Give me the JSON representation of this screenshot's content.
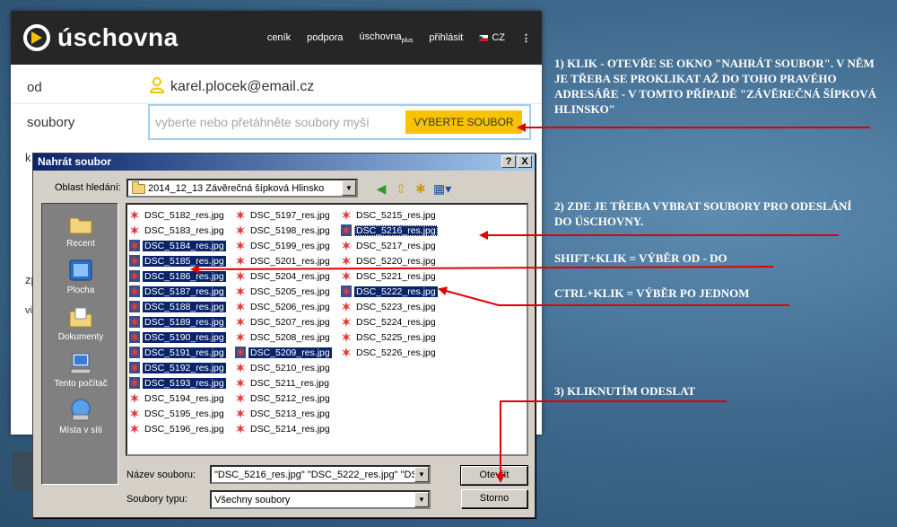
{
  "web": {
    "logo_text": "úschovna",
    "nav": {
      "pricing": "ceník",
      "support": "podpora",
      "plus_main": "úschovna",
      "plus_sub": "plus",
      "login": "přihlásit",
      "lang": "CZ"
    },
    "form": {
      "from_label": "od",
      "from_value": "karel.plocek@email.cz",
      "files_label": "soubory",
      "files_placeholder": "vyberte nebo přetáhněte soubory myší",
      "select_button": "VYBERTE SOUBOR",
      "frag_ko": "k",
      "frag_zp": "zp",
      "frag_vi": "vi"
    }
  },
  "dialog": {
    "title": "Nahrát soubor",
    "help_btn": "?",
    "close_btn": "X",
    "lookin_label": "Oblast hledání:",
    "lookin_value": "2014_12_13 Závěrečná šípková Hlinsko",
    "places": [
      "Recent",
      "Plocha",
      "Dokumenty",
      "Tento počítač",
      "Místa v síti"
    ],
    "columns": [
      [
        {
          "name": "DSC_5182_res.jpg",
          "selected": false
        },
        {
          "name": "DSC_5183_res.jpg",
          "selected": false
        },
        {
          "name": "DSC_5184_res.jpg",
          "selected": true
        },
        {
          "name": "DSC_5185_res.jpg",
          "selected": true
        },
        {
          "name": "DSC_5186_res.jpg",
          "selected": true
        },
        {
          "name": "DSC_5187_res.jpg",
          "selected": true
        },
        {
          "name": "DSC_5188_res.jpg",
          "selected": true
        },
        {
          "name": "DSC_5189_res.jpg",
          "selected": true
        },
        {
          "name": "DSC_5190_res.jpg",
          "selected": true
        },
        {
          "name": "DSC_5191_res.jpg",
          "selected": true
        },
        {
          "name": "DSC_5192_res.jpg",
          "selected": true
        },
        {
          "name": "DSC_5193_res.jpg",
          "selected": true
        },
        {
          "name": "DSC_5194_res.jpg",
          "selected": false
        },
        {
          "name": "DSC_5195_res.jpg",
          "selected": false
        },
        {
          "name": "DSC_5196_res.jpg",
          "selected": false
        }
      ],
      [
        {
          "name": "DSC_5197_res.jpg",
          "selected": false
        },
        {
          "name": "DSC_5198_res.jpg",
          "selected": false
        },
        {
          "name": "DSC_5199_res.jpg",
          "selected": false
        },
        {
          "name": "DSC_5201_res.jpg",
          "selected": false
        },
        {
          "name": "DSC_5204_res.jpg",
          "selected": false
        },
        {
          "name": "DSC_5205_res.jpg",
          "selected": false
        },
        {
          "name": "DSC_5206_res.jpg",
          "selected": false
        },
        {
          "name": "DSC_5207_res.jpg",
          "selected": false
        },
        {
          "name": "DSC_5208_res.jpg",
          "selected": false
        },
        {
          "name": "DSC_5209_res.jpg",
          "selected": true
        },
        {
          "name": "DSC_5210_res.jpg",
          "selected": false
        },
        {
          "name": "DSC_5211_res.jpg",
          "selected": false
        },
        {
          "name": "DSC_5212_res.jpg",
          "selected": false
        },
        {
          "name": "DSC_5213_res.jpg",
          "selected": false
        },
        {
          "name": "DSC_5214_res.jpg",
          "selected": false
        }
      ],
      [
        {
          "name": "DSC_5215_res.jpg",
          "selected": false
        },
        {
          "name": "DSC_5216_res.jpg",
          "selected": true,
          "focus": true
        },
        {
          "name": "DSC_5217_res.jpg",
          "selected": false
        },
        {
          "name": "DSC_5220_res.jpg",
          "selected": false
        },
        {
          "name": "DSC_5221_res.jpg",
          "selected": false
        },
        {
          "name": "DSC_5222_res.jpg",
          "selected": true
        },
        {
          "name": "DSC_5223_res.jpg",
          "selected": false
        },
        {
          "name": "DSC_5224_res.jpg",
          "selected": false
        },
        {
          "name": "DSC_5225_res.jpg",
          "selected": false
        },
        {
          "name": "DSC_5226_res.jpg",
          "selected": false
        }
      ]
    ],
    "filename_label": "Název souboru:",
    "filename_value": "\"DSC_5216_res.jpg\" \"DSC_5222_res.jpg\" \"DS",
    "filetype_label": "Soubory typu:",
    "filetype_value": "Všechny soubory",
    "open_button": "Otevřít",
    "cancel_button": "Storno"
  },
  "annotations": {
    "step1": "1) KLIK - OTEVŘE SE OKNO \"NAHRÁT SOUBOR\". V NĚM JE TŘEBA SE PROKLIKAT AŽ DO TOHO PRAVÉHO ADRESÁŘE - V TOMTO PŘÍPADĚ \"ZÁVĚREČNÁ ŠÍPKOVÁ HLINSKO\"",
    "step2": "2) ZDE JE TŘEBA VYBRAT SOUBORY PRO ODESLÁNÍ DO ÚSCHOVNY.",
    "shift": "SHIFT+KLIK = VÝBĚR OD - DO",
    "ctrl": "CTRL+KLIK = VÝBĚR PO JEDNOM",
    "step3": "3) KLIKNUTÍM ODESLAT"
  },
  "colors": {
    "accent_yellow": "#f7c300",
    "selection": "#0a246a",
    "annotation_red": "#e00000"
  }
}
